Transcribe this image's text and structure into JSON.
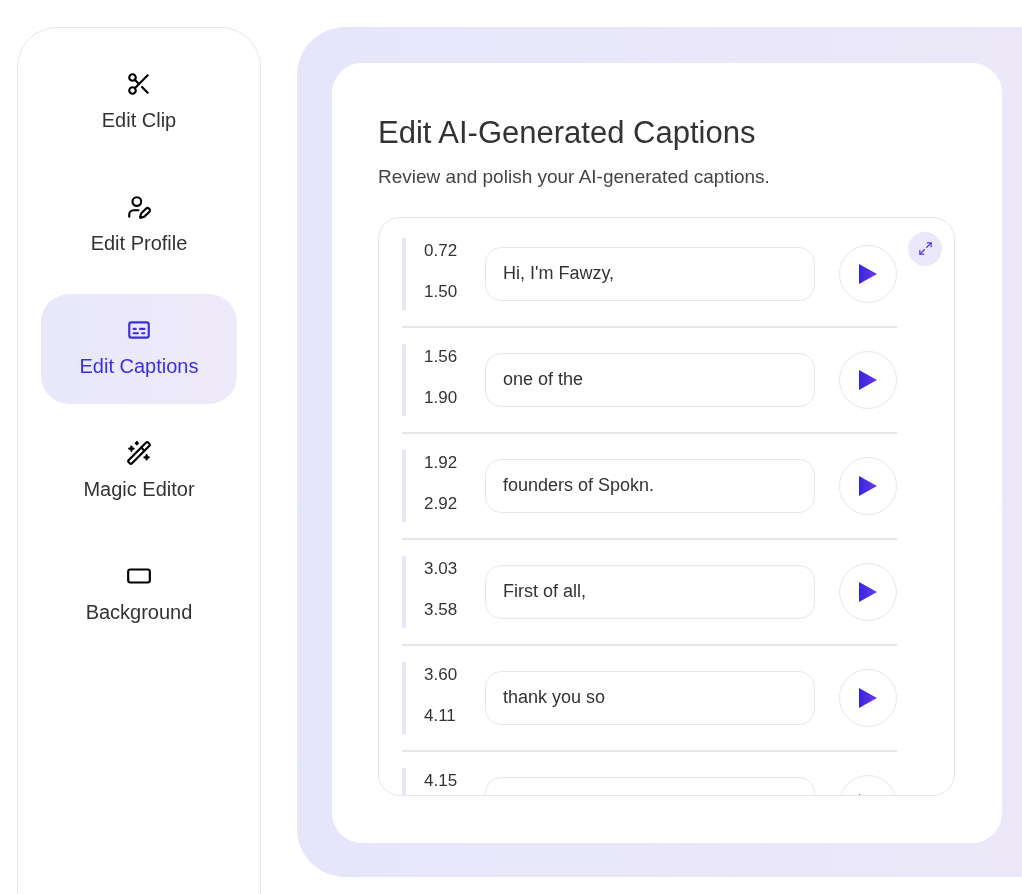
{
  "sidebar": {
    "items": [
      {
        "kind": "scissors",
        "label": "Edit Clip",
        "selected": false
      },
      {
        "kind": "profile",
        "label": "Edit Profile",
        "selected": false
      },
      {
        "kind": "captions",
        "label": "Edit Captions",
        "selected": true
      },
      {
        "kind": "wand",
        "label": "Magic Editor",
        "selected": false
      },
      {
        "kind": "background",
        "label": "Background",
        "selected": false
      }
    ]
  },
  "editor": {
    "title": "Edit AI-Generated Captions",
    "subtitle": "Review and polish your AI-generated captions.",
    "captions": [
      {
        "start": "0.72",
        "end": "1.50",
        "text": "Hi, I'm Fawzy,"
      },
      {
        "start": "1.56",
        "end": "1.90",
        "text": "one of the"
      },
      {
        "start": "1.92",
        "end": "2.92",
        "text": "founders of Spokn."
      },
      {
        "start": "3.03",
        "end": "3.58",
        "text": "First of all,"
      },
      {
        "start": "3.60",
        "end": "4.11",
        "text": "thank you so"
      },
      {
        "start": "4.15"
      }
    ]
  }
}
